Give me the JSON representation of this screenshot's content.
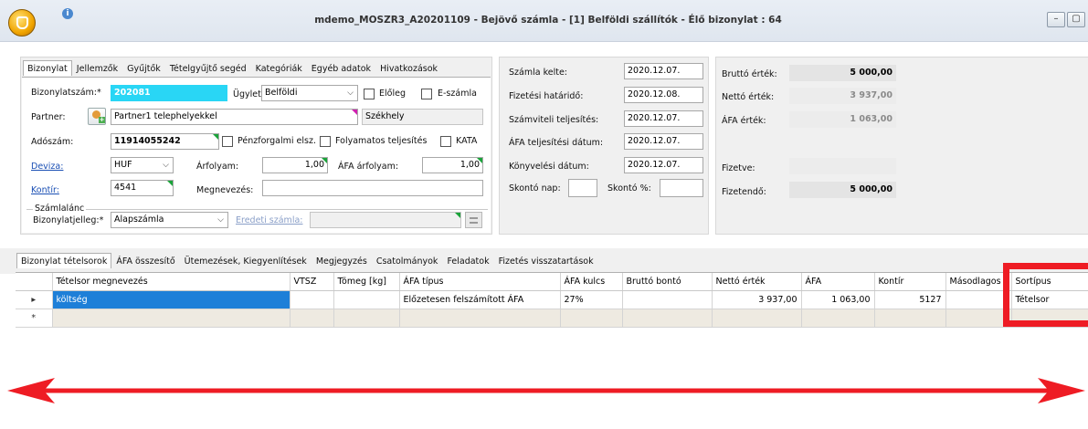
{
  "window": {
    "title": "mdemo_MOSZR3_A20201109 - Bejövő számla - [1] Belföldi szállítók - Élő bizonylat : 64",
    "info_glyph": "i",
    "minimize_glyph": "–",
    "restore_glyph": "▢"
  },
  "doc_tabs": [
    "Bizonylat",
    "Jellemzők",
    "Gyűjtők",
    "Tételgyűjtő segéd",
    "Kategóriák",
    "Egyéb adatok",
    "Hivatkozások"
  ],
  "doc": {
    "bizonylatszam_label": "Bizonylatszám:*",
    "bizonylatszam_value": "202081",
    "ugylet_label": "Ügylet:",
    "ugylet_value": "Belföldi",
    "eloleg_label": "Előleg",
    "eszamla_label": "E-számla",
    "partner_label": "Partner:",
    "partner_value": "Partner1 telephelyekkel",
    "szekhely_value": "Székhely",
    "adoszam_label": "Adószám:",
    "adoszam_value": "11914055242",
    "penzforgalmi_label": "Pénzforgalmi elsz.",
    "folyamatos_label": "Folyamatos teljesítés",
    "kata_label": "KATA",
    "deviza_label": "Deviza:",
    "deviza_value": "HUF",
    "arfolyam_label": "Árfolyam:",
    "arfolyam_value": "1,00",
    "afa_arfolyam_label": "ÁFA árfolyam:",
    "afa_arfolyam_value": "1,00",
    "kontir_label": "Kontír:",
    "kontir_value": "4541",
    "megnevezes_label": "Megnevezés:",
    "megnevezes_value": "",
    "szamlalanc_label": "Számlalánc",
    "bizonylatjelleg_label": "Bizonylatjelleg:*",
    "bizonylatjelleg_value": "Alapszámla",
    "eredeti_szamla_label": "Eredeti számla:",
    "eredeti_szamla_value": ""
  },
  "dates": {
    "szamla_kelte_label": "Számla kelte:",
    "szamla_kelte_value": "2020.12.07.",
    "fizetesi_hatarido_label": "Fizetési határidő:",
    "fizetesi_hatarido_value": "2020.12.08.",
    "szamviteli_label": "Számviteli teljesítés:",
    "szamviteli_value": "2020.12.07.",
    "afa_teljesitesi_label": "ÁFA teljesítési dátum:",
    "afa_teljesitesi_value": "2020.12.07.",
    "konyvelesi_label": "Könyvelési dátum:",
    "konyvelesi_value": "2020.12.07.",
    "skonto_nap_label": "Skontó nap:",
    "skonto_nap_value": "",
    "skonto_pct_label": "Skontó %:",
    "skonto_pct_value": ""
  },
  "totals": {
    "brutto_label": "Bruttó érték:",
    "brutto_value": "5 000,00",
    "netto_label": "Nettó érték:",
    "netto_value": "3 937,00",
    "afa_label": "ÁFA érték:",
    "afa_value": "1 063,00",
    "fizetve_label": "Fizetve:",
    "fizetve_value": "",
    "fizetendo_label": "Fizetendő:",
    "fizetendo_value": "5 000,00"
  },
  "lower_tabs": [
    "Bizonylat tételsorok",
    "ÁFA összesítő",
    "Ütemezések, Kiegyenlítések",
    "Megjegyzés",
    "Csatolmányok",
    "Feladatok",
    "Fizetés visszatartások"
  ],
  "grid": {
    "columns": [
      "",
      "Tételsor megnevezés",
      "VTSZ",
      "Tömeg [kg]",
      "ÁFA típus",
      "ÁFA kulcs",
      "Bruttó bontó",
      "Nettó érték",
      "ÁFA",
      "Kontír",
      "Másodlagos",
      "Sortípus"
    ],
    "rows": [
      [
        "▸",
        "költség",
        "",
        "",
        "Előzetesen felszámított ÁFA",
        "27%",
        "",
        "3 937,00",
        "1 063,00",
        "5127",
        "",
        "Tételsor"
      ]
    ],
    "new_row_marker": "*"
  },
  "annotation_colors": {
    "red": "#ee1c24"
  }
}
